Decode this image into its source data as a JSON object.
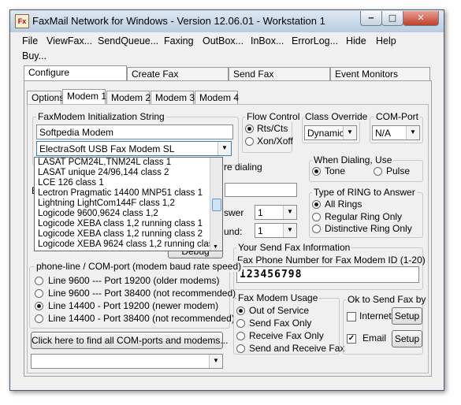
{
  "window": {
    "title": "FaxMail Network for Windows - Version 12.06.01 - Workstation 1",
    "app_icon": "fax",
    "controls": {
      "minimize": "‒",
      "maximize": "□",
      "close": "✕"
    }
  },
  "menu": [
    "File",
    "ViewFax...",
    "SendQueue...",
    "Faxing",
    "OutBox...",
    "InBox...",
    "ErrorLog...",
    "Hide",
    "Help",
    "Buy..."
  ],
  "main_tabs": [
    "Configure",
    "Create Fax",
    "Send Fax",
    "Event Monitors"
  ],
  "sub_tabs": [
    "Options",
    "Modem 1",
    "Modem 2",
    "Modem 3",
    "Modem 4"
  ],
  "init": {
    "label": "FaxModem Initialization String",
    "value": "Softpedia Modem",
    "modem_selected": "ElectraSoft USB Fax Modem SL"
  },
  "modem_list": [
    "LASAT PCM24L,TNM24L class 1",
    "LASAT unique 24/96,144 class 2",
    "LCE 126 class 1",
    "Lectron Pragmatic 14400 MNP51 class 1",
    "Lightning LightCom144F class 1,2",
    "Logicode 9600,9624 class 1,2",
    "Logicode XEBA class 1,2 running class 1",
    "Logicode XEBA class 1,2 running class 2",
    "Logicode XEBA 9624 class 1,2 running class 1"
  ],
  "hidden_fragments": {
    "dialing_suffix": "re dialing",
    "answer_suffix": "swer",
    "round_suffix": "und:",
    "e_prefix": "E",
    "debug": "Debug"
  },
  "answer_rings": "1",
  "round_value": "1",
  "flow_control": {
    "label": "Flow Control",
    "options": [
      "Rts/Cts",
      "Xon/Xoff"
    ],
    "selected": 0
  },
  "class_override": {
    "label": "Class Override",
    "value": "Dynamic"
  },
  "com_port": {
    "label": "COM-Port",
    "value": "N/A"
  },
  "when_dialing": {
    "label": "When Dialing, Use",
    "options": [
      "Tone",
      "Pulse"
    ],
    "selected": 0
  },
  "ring_type": {
    "label": "Type of RING to Answer",
    "options": [
      "All Rings",
      "Regular Ring Only",
      "Distinctive Ring Only"
    ],
    "selected": 0
  },
  "send_fax_info": {
    "label": "Your Send Fax Information",
    "field_label": "Fax Phone Number for Fax Modem ID (1-20)",
    "value": "123456798"
  },
  "phone_line": {
    "label": "phone-line / COM-port (modem baud rate speed)",
    "options": [
      "Line 9600 --- Port 19200 (older modems)",
      "Line 9600 --- Port 38400 (not recommended)",
      "Line 14400 - Port 19200 (newer modem)",
      "Line 14400 - Port 38400 (not recommended)"
    ],
    "selected": 2
  },
  "find_button": "Click here to find all COM-ports and modems...",
  "usage": {
    "label": "Fax Modem Usage",
    "options": [
      "Out of Service",
      "Send Fax Only",
      "Receive Fax Only",
      "Send and Receive Fax"
    ],
    "selected": 0
  },
  "ok_send": {
    "label": "Ok to Send Fax by",
    "internet": {
      "label": "Internet",
      "checked": false
    },
    "email": {
      "label": "Email",
      "checked": true
    },
    "setup": "Setup"
  }
}
